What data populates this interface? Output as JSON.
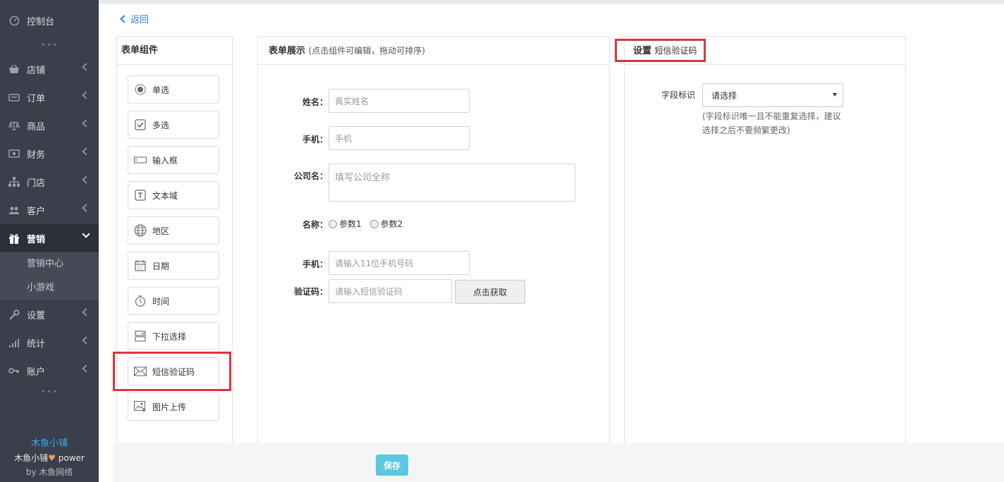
{
  "sidebar": {
    "items": [
      {
        "label": "控制台",
        "icon": "dashboard-icon"
      },
      {
        "label": "店铺",
        "icon": "shop-icon"
      },
      {
        "label": "订单",
        "icon": "order-icon"
      },
      {
        "label": "商品",
        "icon": "scale-icon"
      },
      {
        "label": "财务",
        "icon": "finance-icon"
      },
      {
        "label": "门店",
        "icon": "store-tree-icon"
      },
      {
        "label": "客户",
        "icon": "users-icon"
      },
      {
        "label": "营销",
        "icon": "gift-icon"
      },
      {
        "label": "设置",
        "icon": "wrench-icon"
      },
      {
        "label": "统计",
        "icon": "signal-icon"
      },
      {
        "label": "账户",
        "icon": "key-icon"
      }
    ],
    "sub_items": [
      "营销中心",
      "小游戏"
    ],
    "dots": "•••",
    "footer": {
      "brand": "木鱼小铺",
      "power_prefix": "木鱼小铺",
      "power_suffix": "power",
      "by": "by 木鱼网络"
    }
  },
  "header": {
    "back_label": "返回"
  },
  "components_panel": {
    "title": "表单组件",
    "items": [
      {
        "label": "单选",
        "icon": "radio-icon"
      },
      {
        "label": "多选",
        "icon": "checkbox-icon"
      },
      {
        "label": "输入框",
        "icon": "input-box-icon"
      },
      {
        "label": "文本域",
        "icon": "textarea-icon"
      },
      {
        "label": "地区",
        "icon": "globe-icon"
      },
      {
        "label": "日期",
        "icon": "calendar-icon"
      },
      {
        "label": "时间",
        "icon": "clock-icon"
      },
      {
        "label": "下拉选择",
        "icon": "dropdown-icon"
      },
      {
        "label": "短信验证码",
        "icon": "envelope-icon"
      },
      {
        "label": "图片上传",
        "icon": "image-icon"
      }
    ]
  },
  "preview_panel": {
    "title": "表单展示",
    "hint": "(点击组件可编辑，拖动可排序)",
    "fields": {
      "name_label": "姓名：",
      "name_placeholder": "真实姓名",
      "phone_label": "手机：",
      "phone_placeholder": "手机",
      "company_label": "公司名：",
      "company_placeholder": "填写公司全称",
      "param_label": "名称：",
      "param_options": [
        "参数1",
        "参数2"
      ],
      "mobile_label": "手机：",
      "mobile_placeholder": "请输入11位手机号码",
      "code_label": "验证码：",
      "code_placeholder": "请输入短信验证码",
      "get_code_button": "点击获取"
    }
  },
  "settings_panel": {
    "title": "设置",
    "subtitle": "短信验证码",
    "field_id_label": "字段标识",
    "select_value": "请选择",
    "help_line1": "(字段标识唯一且不能重复选择，建议",
    "help_line2": "选择之后不要频繁更改)"
  },
  "footer": {
    "save_label": "保存"
  },
  "colors": {
    "sidebar_bg": "#3a3f4b",
    "link": "#2b7fd9",
    "highlight": "#d9363e",
    "save_button": "#5bc8e0"
  }
}
